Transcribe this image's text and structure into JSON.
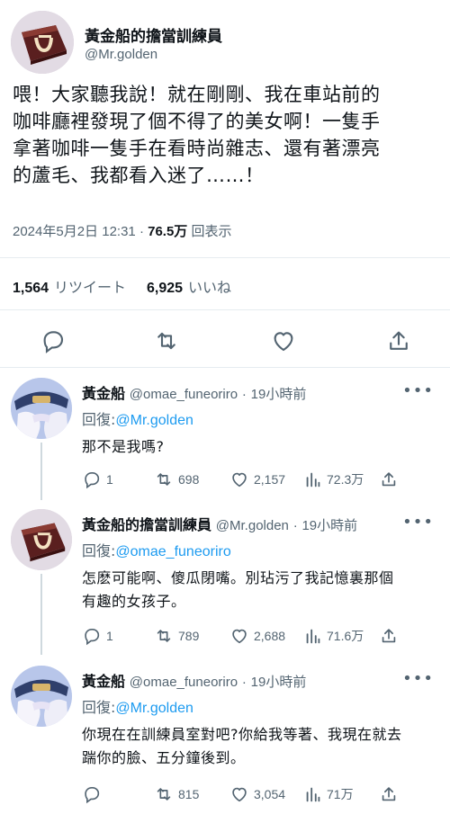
{
  "main_tweet": {
    "display_name": "黃金船的擔當訓練員",
    "handle": "@Mr.golden",
    "text": "喂！大家聽我說！就在剛剛、我在車站前的\n咖啡廳裡發現了個不得了的美女啊！一隻手\n拿著咖啡一隻手在看時尚雜志、還有著漂亮\n的蘆毛、我都看入迷了……！",
    "date_time": "2024年5月2日 12:31",
    "separator": "·",
    "views_count": "76.5万",
    "views_label": "回表示",
    "retweets_count": "1,564",
    "retweets_label": "リツイート",
    "likes_count": "6,925",
    "likes_label": "いいね"
  },
  "replies": [
    {
      "display_name": "黃金船",
      "handle": "@omae_funeoriro",
      "separator": "·",
      "time": "19小時前",
      "reply_prefix": "回復:",
      "reply_to": "@Mr.golden",
      "text": "那不是我嗎?",
      "reply_count": "1",
      "retweet_count": "698",
      "like_count": "2,157",
      "view_count": "72.3万"
    },
    {
      "display_name": "黃金船的擔當訓練員",
      "handle": "@Mr.golden",
      "separator": "·",
      "time": "19小時前",
      "reply_prefix": "回復:",
      "reply_to": "@omae_funeoriro",
      "text": "怎麽可能啊、傻瓜閉嘴。別玷污了我記憶裏那個\n有趣的女孩子。",
      "reply_count": "1",
      "retweet_count": "789",
      "like_count": "2,688",
      "view_count": "71.6万"
    },
    {
      "display_name": "黃金船",
      "handle": "@omae_funeoriro",
      "separator": "·",
      "time": "19小時前",
      "reply_prefix": "回復:",
      "reply_to": "@Mr.golden",
      "text": "你現在在訓練員室對吧?你給我等著、我現在就去\n踹你的臉、五分鐘後到。",
      "reply_count": "",
      "retweet_count": "815",
      "like_count": "3,054",
      "view_count": "71万"
    }
  ],
  "more_label": "•••",
  "colors": {
    "text": "#0f1419",
    "secondary": "#536471",
    "link": "#1d9bf0",
    "divider": "#e6ecf0"
  }
}
